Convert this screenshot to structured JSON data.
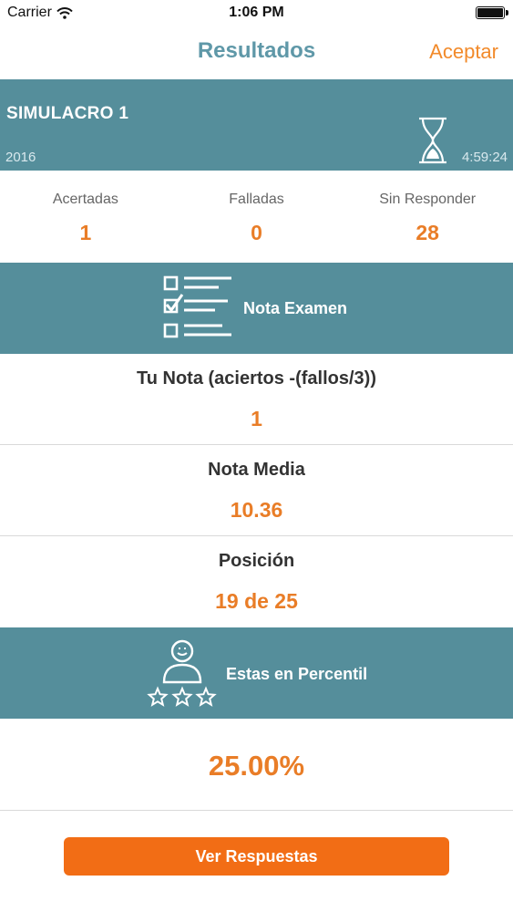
{
  "status_bar": {
    "carrier": "Carrier",
    "time": "1:06 PM"
  },
  "nav": {
    "title": "Resultados",
    "accept": "Aceptar"
  },
  "exam": {
    "name": "SIMULACRO 1",
    "year": "2016",
    "time": "4:59:24"
  },
  "stats": [
    {
      "label": "Acertadas",
      "value": "1"
    },
    {
      "label": "Falladas",
      "value": "0"
    },
    {
      "label": "Sin Responder",
      "value": "28"
    }
  ],
  "nota_banner": {
    "title": "Nota Examen"
  },
  "scores": [
    {
      "label": "Tu Nota (aciertos -(fallos/3))",
      "value": "1"
    },
    {
      "label": "Nota Media",
      "value": "10.36"
    },
    {
      "label": "Posición",
      "value": "19 de 25"
    }
  ],
  "percentil_banner": {
    "title": "Estas en Percentil"
  },
  "percentil": {
    "value": "25.00%"
  },
  "actions": {
    "ver_respuestas": "Ver Respuestas"
  },
  "colors": {
    "accent": "#e97d27",
    "banner": "#558e9b",
    "title": "#5f98a8",
    "button": "#f26d15"
  },
  "icons": [
    "wifi-icon",
    "battery-icon",
    "hourglass-icon",
    "checklist-icon",
    "user-rating-icon"
  ]
}
